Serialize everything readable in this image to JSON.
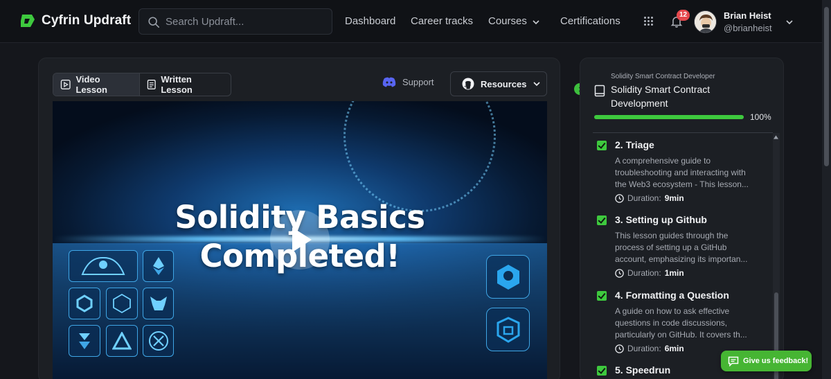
{
  "brand": {
    "name": "Cyfrin Updraft",
    "accent": "#3ec93e"
  },
  "search": {
    "placeholder": "Search Updraft..."
  },
  "nav": {
    "dashboard": "Dashboard",
    "career_tracks": "Career tracks",
    "courses": "Courses",
    "certifications": "Certifications"
  },
  "user": {
    "notification_count": "12",
    "name": "Brian Heist",
    "handle": "@brianheist"
  },
  "lesson_view": {
    "video_tab": "Video Lesson",
    "written_tab": "Written Lesson",
    "support": "Support",
    "resources": "Resources",
    "video_title_line1": "Solidity Basics",
    "video_title_line2": "Completed!"
  },
  "course": {
    "track": "Solidity Smart Contract Developer",
    "title": "Solidity Smart Contract Development",
    "progress_percent": 100,
    "progress_label": "100%",
    "duration_prefix": "Duration:",
    "lessons": [
      {
        "title": "2. Triage",
        "description": "A comprehensive guide to troubleshooting and interacting with the Web3 ecosystem - This lesson...",
        "duration": "9min",
        "completed": true
      },
      {
        "title": "3. Setting up Github",
        "description": "This lesson guides through the process of setting up a GitHub account, emphasizing its importan...",
        "duration": "1min",
        "completed": true
      },
      {
        "title": "4. Formatting a Question",
        "description": "A guide on how to ask effective questions in code discussions, particularly on GitHub. It covers th...",
        "duration": "6min",
        "completed": true
      },
      {
        "title": "5. Speedrun",
        "completed": true
      }
    ]
  },
  "feedback": {
    "label": "Give us feedback!"
  }
}
